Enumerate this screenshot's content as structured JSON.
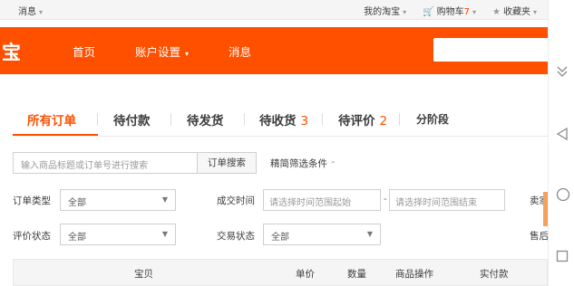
{
  "sitebar": {
    "messages": "消息",
    "my_taobao": "我的淘宝",
    "cart_label": "购物车",
    "cart_count": "7",
    "favorites": "收藏夹"
  },
  "header": {
    "logo": "宝",
    "nav": [
      "首页",
      "账户设置",
      "消息"
    ]
  },
  "tabs": [
    {
      "label": "所有订单",
      "count": ""
    },
    {
      "label": "待付款",
      "count": ""
    },
    {
      "label": "待发货",
      "count": ""
    },
    {
      "label": "待收货",
      "count": "3"
    },
    {
      "label": "待评价",
      "count": "2"
    },
    {
      "label": "分阶段",
      "count": ""
    }
  ],
  "search": {
    "placeholder": "输入商品标题或订单号进行搜索",
    "button": "订单搜索",
    "filter_toggle": "精简筛选条件"
  },
  "filters": {
    "order_type_label": "订单类型",
    "order_type_value": "全部",
    "deal_time_label": "成交时间",
    "date_start_placeholder": "请选择时间范围起始",
    "date_sep": "-",
    "date_end_placeholder": "请选择时间范围结束",
    "seller_label_cut": "卖家",
    "review_status_label": "评价状态",
    "review_status_value": "全部",
    "trade_status_label": "交易状态",
    "trade_status_value": "全部",
    "aftersale_label_cut": "售后"
  },
  "table": {
    "headers": [
      "宝贝",
      "单价",
      "数量",
      "商品操作",
      "实付款"
    ]
  },
  "colors": {
    "brand": "#ff5000",
    "cart_count": "#ff4400"
  }
}
